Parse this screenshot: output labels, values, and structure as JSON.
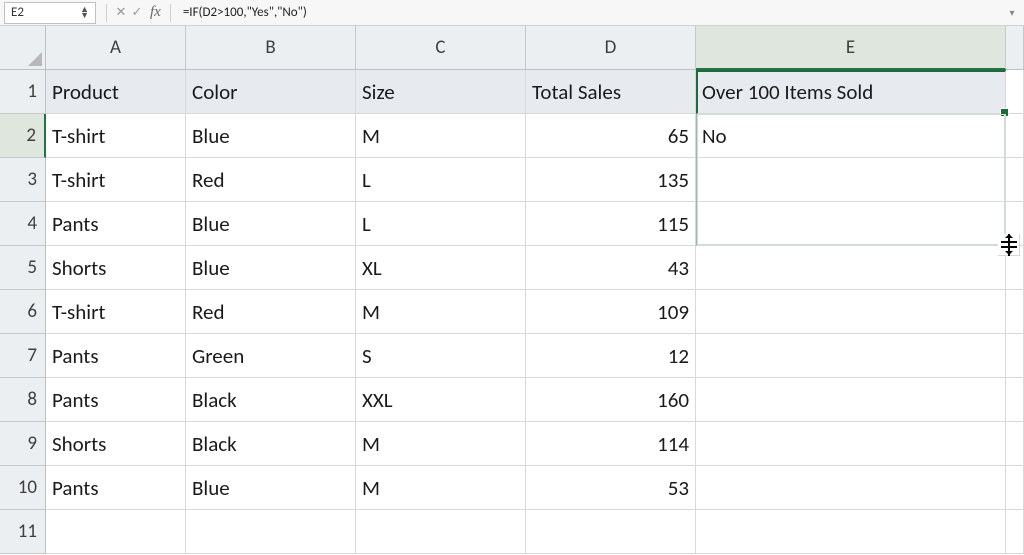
{
  "formula_bar": {
    "cell_ref": "E2",
    "fx_label": "fx",
    "formula": "=IF(D2>100,\"Yes\",\"No\")"
  },
  "columns": [
    "A",
    "B",
    "C",
    "D",
    "E"
  ],
  "active_col_index": 4,
  "row_headers": [
    "1",
    "2",
    "3",
    "4",
    "5",
    "6",
    "7",
    "8",
    "9",
    "10",
    "11"
  ],
  "active_row_index": 1,
  "headers": {
    "A": "Product",
    "B": "Color",
    "C": "Size",
    "D": "Total Sales",
    "E": "Over 100 Items Sold"
  },
  "rows": [
    {
      "A": "T-shirt",
      "B": "Blue",
      "C": "M",
      "D": "65",
      "E": "No"
    },
    {
      "A": "T-shirt",
      "B": "Red",
      "C": "L",
      "D": "135",
      "E": ""
    },
    {
      "A": "Pants",
      "B": "Blue",
      "C": "L",
      "D": "115",
      "E": ""
    },
    {
      "A": "Shorts",
      "B": "Blue",
      "C": "XL",
      "D": "43",
      "E": ""
    },
    {
      "A": "T-shirt",
      "B": "Red",
      "C": "M",
      "D": "109",
      "E": ""
    },
    {
      "A": "Pants",
      "B": "Green",
      "C": "S",
      "D": "12",
      "E": ""
    },
    {
      "A": "Pants",
      "B": "Black",
      "C": "XXL",
      "D": "160",
      "E": ""
    },
    {
      "A": "Shorts",
      "B": "Black",
      "C": "M",
      "D": "114",
      "E": ""
    },
    {
      "A": "Pants",
      "B": "Blue",
      "C": "M",
      "D": "53",
      "E": ""
    },
    {
      "A": "",
      "B": "",
      "C": "",
      "D": "",
      "E": ""
    }
  ],
  "chart_data": {
    "type": "table",
    "title": "",
    "columns": [
      "Product",
      "Color",
      "Size",
      "Total Sales",
      "Over 100 Items Sold"
    ],
    "records": [
      [
        "T-shirt",
        "Blue",
        "M",
        65,
        "No"
      ],
      [
        "T-shirt",
        "Red",
        "L",
        135,
        null
      ],
      [
        "Pants",
        "Blue",
        "L",
        115,
        null
      ],
      [
        "Shorts",
        "Blue",
        "XL",
        43,
        null
      ],
      [
        "T-shirt",
        "Red",
        "M",
        109,
        null
      ],
      [
        "Pants",
        "Green",
        "S",
        12,
        null
      ],
      [
        "Pants",
        "Black",
        "XXL",
        160,
        null
      ],
      [
        "Shorts",
        "Black",
        "M",
        114,
        null
      ],
      [
        "Pants",
        "Blue",
        "M",
        53,
        null
      ]
    ]
  }
}
